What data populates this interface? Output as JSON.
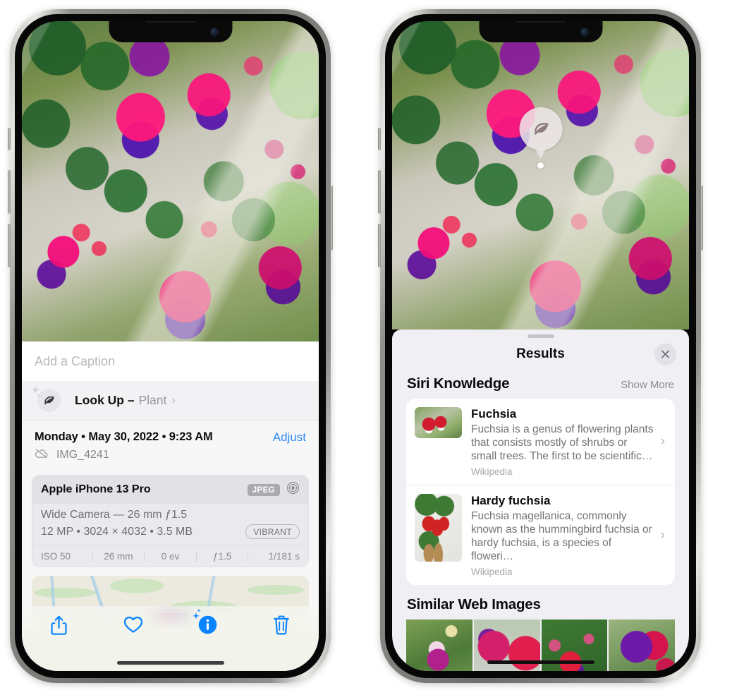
{
  "left_phone": {
    "caption": {
      "placeholder": "Add a Caption",
      "value": ""
    },
    "lookup": {
      "label": "Look Up –",
      "subject": "Plant",
      "chevron": "›",
      "icon": "leaf-icon",
      "sparkle": "sparkle-icon"
    },
    "meta": {
      "date": "Monday • May 30, 2022 • 9:23 AM",
      "adjust_label": "Adjust",
      "filename": "IMG_4241",
      "cloud_icon": "cloud-slash-icon"
    },
    "camera_card": {
      "device": "Apple iPhone 13 Pro",
      "format_badge": "JPEG",
      "aperture_icon": "camera-aperture-icon",
      "lens_line": "Wide Camera — 26 mm ƒ1.5",
      "spec_line": "12 MP • 3024 × 4032 • 3.5 MB",
      "style_badge": "VIBRANT",
      "exif": [
        "ISO 50",
        "26 mm",
        "0 ev",
        "ƒ1.5",
        "1/181 s"
      ]
    },
    "toolbar": [
      {
        "name": "share-icon",
        "label": "Share"
      },
      {
        "name": "heart-icon",
        "label": "Favorite"
      },
      {
        "name": "info-sparkle-icon",
        "label": "Info"
      },
      {
        "name": "trash-icon",
        "label": "Delete"
      }
    ],
    "accent_color": "#0a84ff",
    "link_color": "#2e8bf5"
  },
  "right_phone": {
    "badge": {
      "icon": "leaf-icon",
      "name": "visual-look-up-badge"
    },
    "sheet": {
      "title": "Results",
      "close_icon": "close-icon",
      "sections": [
        {
          "title": "Siri Knowledge",
          "action": "Show More",
          "items": [
            {
              "name": "Fuchsia",
              "description": "Fuchsia is a genus of flowering plants that consists mostly of shrubs or small trees. The first to be scientific…",
              "source": "Wikipedia",
              "thumb": "fuchsia-thumbnail"
            },
            {
              "name": "Hardy fuchsia",
              "description": "Fuchsia magellanica, commonly known as the hummingbird fuchsia or hardy fuchsia, is a species of floweri…",
              "source": "Wikipedia",
              "thumb": "hardy-fuchsia-thumbnail"
            }
          ]
        },
        {
          "title": "Similar Web Images",
          "action": "",
          "thumbnails": [
            "web-image-1",
            "web-image-2",
            "web-image-3",
            "web-image-4"
          ]
        }
      ]
    }
  }
}
